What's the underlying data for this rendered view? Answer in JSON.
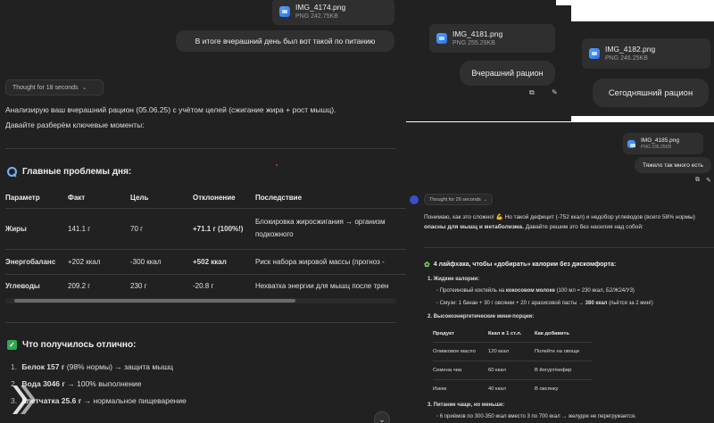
{
  "left": {
    "attachment": {
      "name": "IMG_4174.png",
      "meta": "PNG 242.75KB"
    },
    "user_message": "В итоге вчерашний день был вот такой по питанию",
    "thought_label": "Thought for 18 seconds",
    "intro_line1": "Анализирую ваш вчерашний рацион (05.06.25) с учётом целей (сжигание жира + рост мышц).",
    "intro_line2": "Давайте разберём ключевые моменты:",
    "problems_heading": "Главные проблемы дня:",
    "table": {
      "headers": [
        "Параметр",
        "Факт",
        "Цель",
        "Отклонение",
        "Последствие"
      ],
      "rows": [
        {
          "param": "Жиры",
          "fact": "141.1 г",
          "goal": "70 г",
          "dev": "+71.1 г (100%!)",
          "cons1": "Блокировка жиросжигания → организм",
          "cons2": "подкожного"
        },
        {
          "param": "Энергобаланс",
          "fact": "+202 ккал",
          "goal": "-300 ккал",
          "dev": "+502 ккал",
          "cons1": "Риск набора жировой массы (прогноз -",
          "cons2": ""
        },
        {
          "param": "Углеводы",
          "fact": "209.2 г",
          "goal": "230 г",
          "dev": "-20.8 г",
          "cons1": "Нехватка энергии для мышц после трен",
          "cons2": ""
        }
      ]
    },
    "good_heading": "Что получилось отлично:",
    "good_list": [
      {
        "num": "1.",
        "bold": "Белок 157 г",
        "rest": " (98% нормы) → защита мышц"
      },
      {
        "num": "2.",
        "bold": "Вода 3046 г",
        "rest": " → 100% выполнение"
      },
      {
        "num": "3.",
        "bold": "Клетчатка 25.6 г",
        "rest": " → нормальное пищеварение"
      }
    ],
    "scroll_down": "⌄"
  },
  "right": {
    "attachment_a": {
      "name": "IMG_4181.png",
      "meta": "PNG 255.29KB"
    },
    "message_a": "Вчерашний рацион",
    "attachment_b": {
      "name": "IMG_4182.png",
      "meta": "PNG 246.25KB"
    },
    "message_b": "Сегодняшний рацион",
    "attachment_c": {
      "name": "IMG_4185.png",
      "meta": "PNG 236.25KB"
    },
    "message_c": "Тяжело так много есть",
    "thought_label": "Thought for 26 seconds",
    "intro_1": "Понимаю, как это сложно! 💪 Но такой дефицит (-752 ккал) и недобор углеводов (всего 58% нормы)",
    "intro_2_bold": "опасны для мышц и метаболизма.",
    "intro_2_rest": " Давайте решим это без насилия над собой:",
    "hacks_heading": "4 лайфхака, чтобы «добирать» калории без дискомфорта:",
    "item1_title": "Жидкие калории:",
    "item1_b1_a": "Протеиновый коктейль на ",
    "item1_b1_bold": "кокосовом молоке",
    "item1_b1_b": " (100 мл = 230 ккал, Б2/Ж24/У3)",
    "item1_b2_a": "Смузи: 1 банан + 30 г овсянки + 20 г арахисовой пасты → ",
    "item1_b2_bold": "380 ккал",
    "item1_b2_b": " (пьётся за 2 мин!)",
    "item2_title": "Высокоэнергетические мини-порции:",
    "table": {
      "headers": [
        "Продукт",
        "Ккал в 1 ст.л.",
        "Как добавить"
      ],
      "rows": [
        [
          "Оливковое масло",
          "120 ккал",
          "Полейте на овощи"
        ],
        [
          "Семена чиа",
          "60 ккал",
          "В йогурт/кефир"
        ],
        [
          "Изюм",
          "40 ккал",
          "В овсянку"
        ]
      ]
    },
    "item3_title": "Питание чаще, но меньше:",
    "item3_b1": "6 приёмов по 300-350 ккал вместо 3 по 700 ккал → желудок не перегружается."
  }
}
